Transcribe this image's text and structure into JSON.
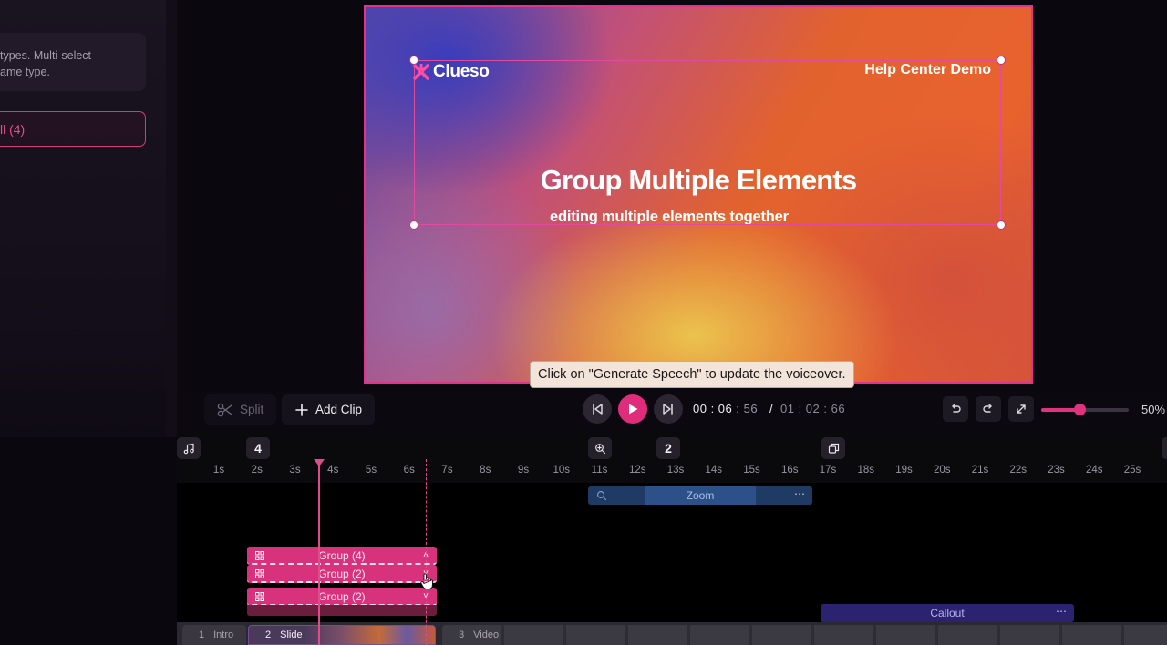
{
  "side_panel": {
    "hint_line1": "types. Multi-select",
    "hint_line2": "ame type.",
    "select_all_label": "ll (4)"
  },
  "slide": {
    "logo_text": "Clueso",
    "corner_text": "Help Center Demo",
    "title": "Group Multiple Elements",
    "subtitle": "editing multiple elements together"
  },
  "toast": {
    "text": "Click on \"Generate Speech\" to update the voiceover."
  },
  "toolbar": {
    "split_label": "Split",
    "add_clip_label": "Add Clip",
    "time_current": "00 : 06 :",
    "time_current_ms": "56",
    "time_separator": "/",
    "time_total": "01 : 02 : 66",
    "zoom_level_label": "50%",
    "zoom_level_fraction": 0.44
  },
  "timeline": {
    "ticks": [
      "1s",
      "2s",
      "3s",
      "4s",
      "5s",
      "6s",
      "7s",
      "8s",
      "9s",
      "10s",
      "11s",
      "12s",
      "13s",
      "14s",
      "15s",
      "16s",
      "17s",
      "18s",
      "19s",
      "20s",
      "21s",
      "22s",
      "23s",
      "24s",
      "25s",
      "2"
    ],
    "marker_counts": [
      "4",
      "2"
    ],
    "zoom_track_label": "Zoom",
    "groups": [
      "Group (4)",
      "Group (2)",
      "Group (2)"
    ],
    "callout_label": "Callout",
    "clips": [
      {
        "number": "1",
        "name": "Intro"
      },
      {
        "number": "2",
        "name": "Slide"
      },
      {
        "number": "3",
        "name": "Video"
      }
    ]
  },
  "colors": {
    "accent": "#df2d7c",
    "zoom_track": "#1f3a63",
    "callout_track": "#2b2370"
  }
}
